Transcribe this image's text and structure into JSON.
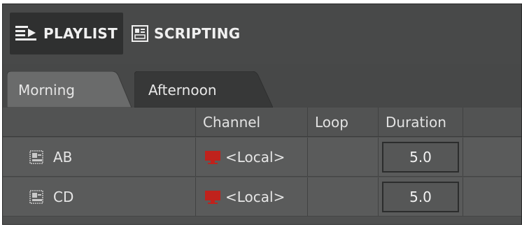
{
  "toolbar": {
    "playlist_label": "PLAYLIST",
    "scripting_label": "SCRIPTING"
  },
  "tabs": [
    {
      "label": "Morning",
      "active": true
    },
    {
      "label": "Afternoon",
      "active": false
    }
  ],
  "table": {
    "columns": [
      "",
      "Channel",
      "Loop",
      "Duration",
      ""
    ],
    "rows": [
      {
        "name": "AB",
        "channel": "<Local>",
        "loop": "",
        "duration": "5.0"
      },
      {
        "name": "CD",
        "channel": "<Local>",
        "loop": "",
        "duration": "5.0"
      }
    ]
  },
  "icons": {
    "playlist": "playlist-icon",
    "scripting": "scripting-icon",
    "item": "image-item-icon",
    "channel": "monitor-icon"
  },
  "colors": {
    "channel_icon": "#c0221c",
    "panel_bg": "#4b4c4c"
  }
}
